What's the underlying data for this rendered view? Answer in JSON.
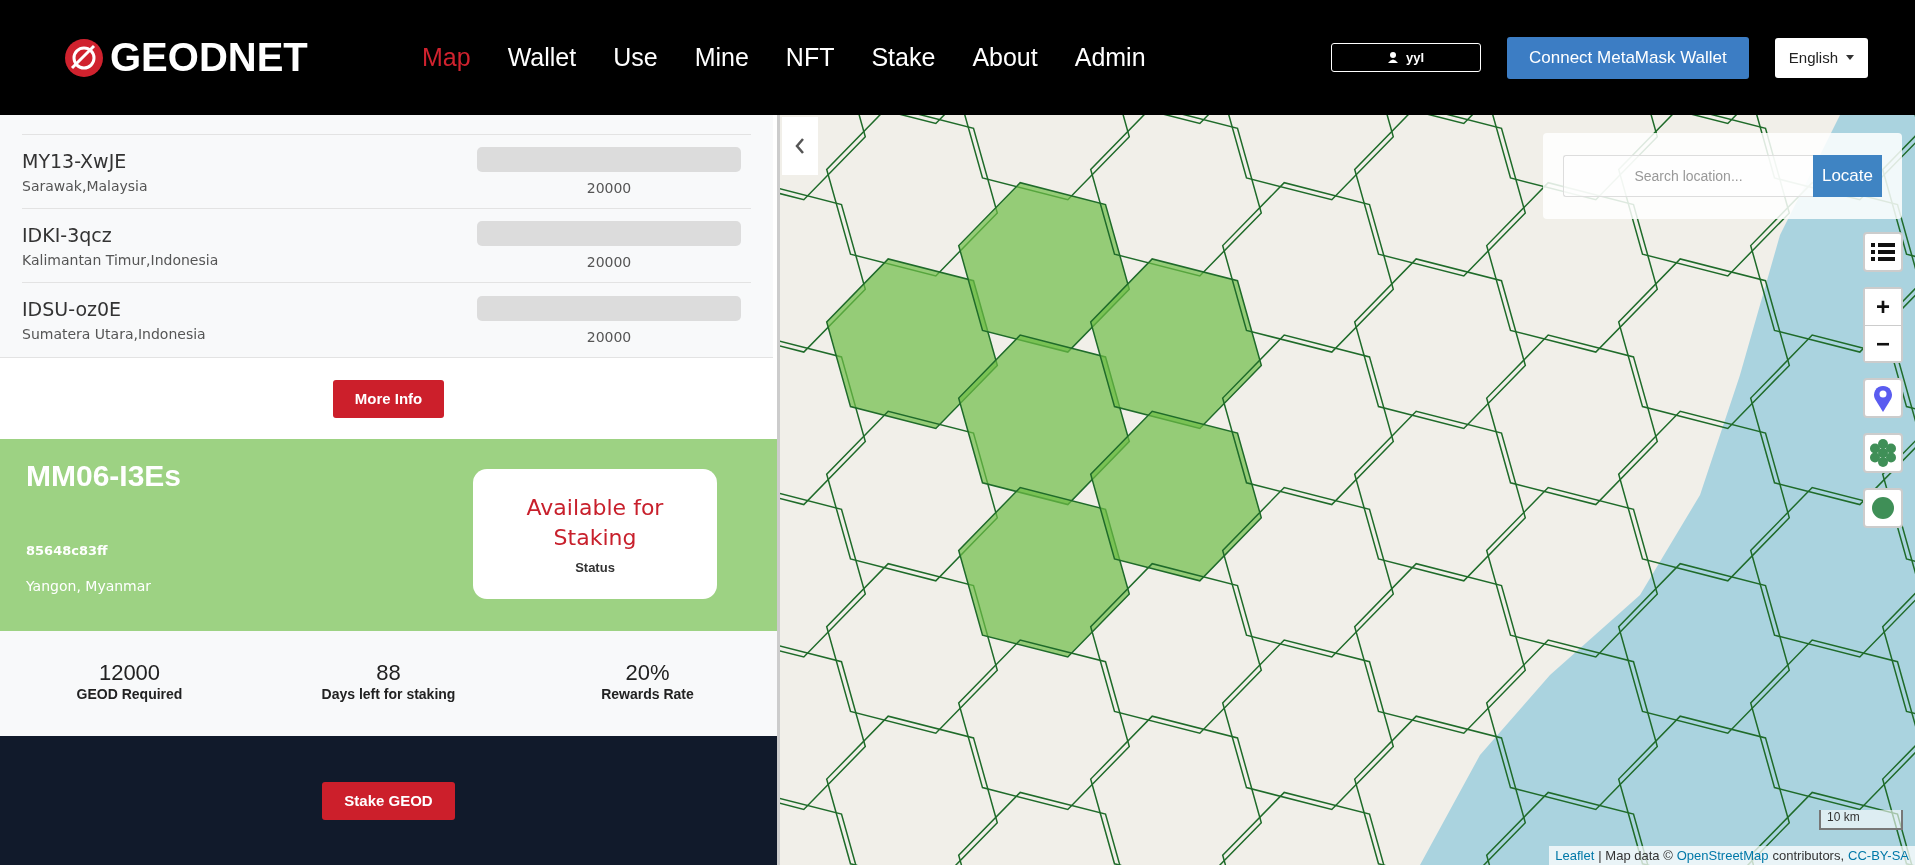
{
  "header": {
    "brand": "GEODNET",
    "nav": [
      {
        "label": "Map",
        "selected": true
      },
      {
        "label": "Wallet",
        "selected": false
      },
      {
        "label": "Use",
        "selected": false
      },
      {
        "label": "Mine",
        "selected": false
      },
      {
        "label": "NFT",
        "selected": false
      },
      {
        "label": "Stake",
        "selected": false
      },
      {
        "label": "About",
        "selected": false
      },
      {
        "label": "Admin",
        "selected": false
      }
    ],
    "user": "yyl",
    "connect_button": "Connect MetaMask Wallet",
    "language": "English"
  },
  "station_list": {
    "rows": [
      {
        "name": "MY13-XwJE",
        "location": "Sarawak,Malaysia",
        "level": 0,
        "amount": "20000"
      },
      {
        "name": "IDKI-3qcz",
        "location": "Kalimantan Timur,Indonesia",
        "level": 0,
        "amount": "20000"
      },
      {
        "name": "IDSU-oz0E",
        "location": "Sumatera Utara,Indonesia",
        "level": 0,
        "amount": "20000"
      }
    ],
    "more_button": "More Info"
  },
  "station_card": {
    "name": "MM06-I3Es",
    "hash": "85648c83ff",
    "location": "Yangon, Myanmar",
    "status": "Available for Staking",
    "status_label": "Status"
  },
  "stats": [
    {
      "value": "12000",
      "label": "GEOD Required"
    },
    {
      "value": "88",
      "label": "Days left for staking"
    },
    {
      "value": "20%",
      "label": "Rewards Rate"
    }
  ],
  "stake_button": "Stake GEOD",
  "map": {
    "search": {
      "placeholder": "Search location...",
      "button": "Locate"
    },
    "zoom_in": "+",
    "zoom_out": "−",
    "scale": "10 km",
    "attribution": [
      {
        "text": "Leaflet",
        "link": true
      },
      {
        "text": "| Map data ©",
        "link": false
      },
      {
        "text": "OpenStreetMap",
        "link": true
      },
      {
        "text": "contributors,",
        "link": false
      },
      {
        "text": "CC-BY-SA",
        "link": true
      }
    ]
  }
}
